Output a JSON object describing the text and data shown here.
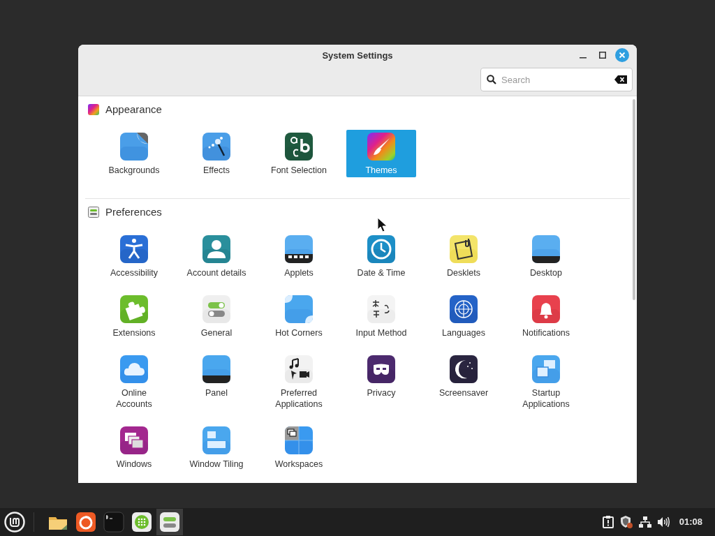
{
  "window": {
    "title": "System Settings"
  },
  "search": {
    "placeholder": "Search"
  },
  "sections": [
    {
      "title": "Appearance",
      "items": [
        {
          "label": "Backgrounds",
          "selected": false
        },
        {
          "label": "Effects",
          "selected": false
        },
        {
          "label": "Font Selection",
          "selected": false
        },
        {
          "label": "Themes",
          "selected": true
        }
      ]
    },
    {
      "title": "Preferences",
      "items": [
        {
          "label": "Accessibility",
          "selected": false
        },
        {
          "label": "Account details",
          "selected": false
        },
        {
          "label": "Applets",
          "selected": false
        },
        {
          "label": "Date & Time",
          "selected": false
        },
        {
          "label": "Desklets",
          "selected": false
        },
        {
          "label": "Desktop",
          "selected": false
        },
        {
          "label": "Extensions",
          "selected": false
        },
        {
          "label": "General",
          "selected": false
        },
        {
          "label": "Hot Corners",
          "selected": false
        },
        {
          "label": "Input Method",
          "selected": false
        },
        {
          "label": "Languages",
          "selected": false
        },
        {
          "label": "Notifications",
          "selected": false
        },
        {
          "label": "Online Accounts",
          "selected": false
        },
        {
          "label": "Panel",
          "selected": false
        },
        {
          "label": "Preferred Applications",
          "selected": false
        },
        {
          "label": "Privacy",
          "selected": false
        },
        {
          "label": "Screensaver",
          "selected": false
        },
        {
          "label": "Startup Applications",
          "selected": false
        },
        {
          "label": "Windows",
          "selected": false
        },
        {
          "label": "Window Tiling",
          "selected": false
        },
        {
          "label": "Workspaces",
          "selected": false
        }
      ]
    }
  ],
  "taskbar": {
    "apps": [
      {
        "active": false
      },
      {
        "active": false
      },
      {
        "active": false
      },
      {
        "active": false
      },
      {
        "active": true
      }
    ],
    "clock": "01:08"
  }
}
